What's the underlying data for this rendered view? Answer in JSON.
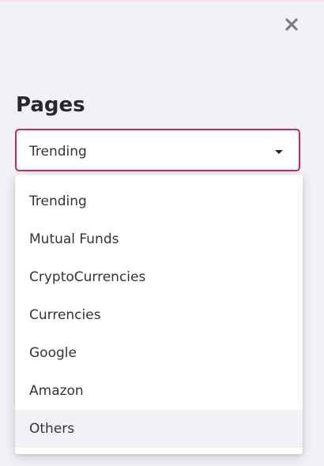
{
  "close": {
    "label": "×",
    "icon": "close-icon"
  },
  "sidebar": {
    "title": "Pages"
  },
  "select": {
    "value": "Trending",
    "icon": "chevron-down-icon",
    "accent_color": "#d0245e"
  },
  "options": [
    {
      "label": "Trending"
    },
    {
      "label": "Mutual Funds"
    },
    {
      "label": "CryptoCurrencies"
    },
    {
      "label": "Currencies"
    },
    {
      "label": "Google"
    },
    {
      "label": "Amazon"
    },
    {
      "label": "Others"
    }
  ]
}
